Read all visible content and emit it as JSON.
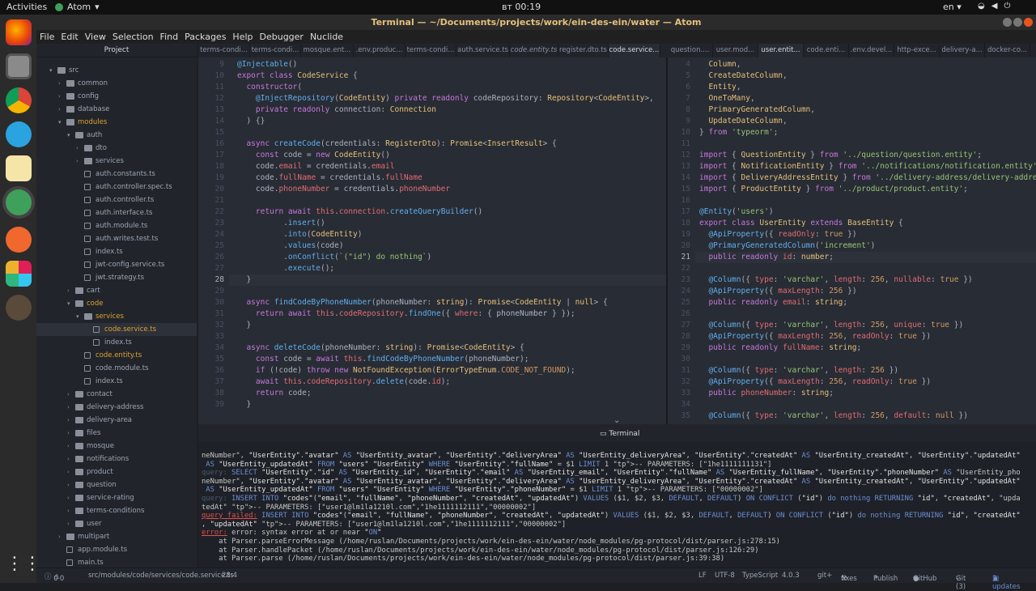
{
  "topbar": {
    "activities": "Activities",
    "app": "Atom",
    "clock": "вт 00:19",
    "lang": "en"
  },
  "window": {
    "title": "Terminal — ~/Documents/projects/work/ein-des-ein/water — Atom"
  },
  "menu": [
    "File",
    "Edit",
    "View",
    "Selection",
    "Find",
    "Packages",
    "Help",
    "Debugger",
    "Nuclide"
  ],
  "tree": {
    "header": "Project",
    "items": [
      {
        "label": "src",
        "depth": 0,
        "type": "folder",
        "open": true
      },
      {
        "label": "common",
        "depth": 1,
        "type": "folder"
      },
      {
        "label": "config",
        "depth": 1,
        "type": "folder"
      },
      {
        "label": "database",
        "depth": 1,
        "type": "folder"
      },
      {
        "label": "modules",
        "depth": 1,
        "type": "folder",
        "open": true,
        "hl": "orange"
      },
      {
        "label": "auth",
        "depth": 2,
        "type": "folder",
        "open": true
      },
      {
        "label": "dto",
        "depth": 3,
        "type": "folder"
      },
      {
        "label": "services",
        "depth": 3,
        "type": "folder"
      },
      {
        "label": "auth.constants.ts",
        "depth": 3,
        "type": "file"
      },
      {
        "label": "auth.controller.spec.ts",
        "depth": 3,
        "type": "file"
      },
      {
        "label": "auth.controller.ts",
        "depth": 3,
        "type": "file"
      },
      {
        "label": "auth.interface.ts",
        "depth": 3,
        "type": "file"
      },
      {
        "label": "auth.module.ts",
        "depth": 3,
        "type": "file"
      },
      {
        "label": "auth.writes.test.ts",
        "depth": 3,
        "type": "file"
      },
      {
        "label": "index.ts",
        "depth": 3,
        "type": "file"
      },
      {
        "label": "jwt-config.service.ts",
        "depth": 3,
        "type": "file"
      },
      {
        "label": "jwt.strategy.ts",
        "depth": 3,
        "type": "file"
      },
      {
        "label": "cart",
        "depth": 2,
        "type": "folder"
      },
      {
        "label": "code",
        "depth": 2,
        "type": "folder",
        "open": true,
        "hl": "orange"
      },
      {
        "label": "services",
        "depth": 3,
        "type": "folder",
        "open": true,
        "hl": "orange"
      },
      {
        "label": "code.service.ts",
        "depth": 4,
        "type": "file",
        "hl": "orange",
        "sel": true
      },
      {
        "label": "index.ts",
        "depth": 4,
        "type": "file"
      },
      {
        "label": "code.entity.ts",
        "depth": 3,
        "type": "file",
        "hl": "orange"
      },
      {
        "label": "code.module.ts",
        "depth": 3,
        "type": "file"
      },
      {
        "label": "index.ts",
        "depth": 3,
        "type": "file"
      },
      {
        "label": "contact",
        "depth": 2,
        "type": "folder"
      },
      {
        "label": "delivery-address",
        "depth": 2,
        "type": "folder"
      },
      {
        "label": "delivery-area",
        "depth": 2,
        "type": "folder"
      },
      {
        "label": "files",
        "depth": 2,
        "type": "folder"
      },
      {
        "label": "mosque",
        "depth": 2,
        "type": "folder"
      },
      {
        "label": "notifications",
        "depth": 2,
        "type": "folder"
      },
      {
        "label": "product",
        "depth": 2,
        "type": "folder"
      },
      {
        "label": "question",
        "depth": 2,
        "type": "folder"
      },
      {
        "label": "service-rating",
        "depth": 2,
        "type": "folder"
      },
      {
        "label": "terms-conditions",
        "depth": 2,
        "type": "folder"
      },
      {
        "label": "user",
        "depth": 2,
        "type": "folder"
      },
      {
        "label": "multipart",
        "depth": 1,
        "type": "folder"
      },
      {
        "label": "app.module.ts",
        "depth": 1,
        "type": "file"
      },
      {
        "label": "main.ts",
        "depth": 1,
        "type": "file"
      }
    ]
  },
  "tabs_left": [
    "terms-condi...",
    "terms-condi...",
    "mosque.ent...",
    ".env.produc...",
    "terms-condi...",
    "auth.service.ts",
    "code.entity.ts",
    "register.dto.ts",
    "code.service..."
  ],
  "tabs_right": [
    "question....",
    "user.mod...",
    "user.entit...",
    "code.enti...",
    ".env.devel...",
    "http-exce...",
    "delivery-a...",
    "docker-co..."
  ],
  "left_code": [
    {
      "n": "9",
      "html": "<span class='f'>@Injectable</span>()"
    },
    {
      "n": "10",
      "html": "<span class='k'>export class</span> <span class='t'>CodeService</span> {"
    },
    {
      "n": "11",
      "html": "  <span class='k'>constructor</span>("
    },
    {
      "n": "12",
      "html": "    <span class='f'>@InjectRepository</span>(<span class='t'>CodeEntity</span>) <span class='k'>private readonly</span> codeRepository: <span class='t'>Repository</span>&lt;<span class='t'>CodeEntity</span>&gt;,"
    },
    {
      "n": "13",
      "html": "    <span class='k'>private readonly</span> connection: <span class='t'>Connection</span>"
    },
    {
      "n": "14",
      "html": "  ) {}"
    },
    {
      "n": "15",
      "html": ""
    },
    {
      "n": "16",
      "html": "  <span class='k'>async</span> <span class='f'>createCode</span>(credentials: <span class='t'>RegisterDto</span>): <span class='t'>Promise</span>&lt;<span class='t'>InsertResult</span>&gt; {"
    },
    {
      "n": "17",
      "html": "    <span class='k'>const</span> code = <span class='k'>new</span> <span class='t'>CodeEntity</span>()"
    },
    {
      "n": "18",
      "html": "    code.<span class='p'>email</span> = credentials.<span class='p'>email</span>"
    },
    {
      "n": "19",
      "html": "    code.<span class='p'>fullName</span> = credentials.<span class='p'>fullName</span>"
    },
    {
      "n": "20",
      "html": "    code.<span class='p'>phoneNumber</span> = credentials.<span class='p'>phoneNumber</span>"
    },
    {
      "n": "21",
      "html": ""
    },
    {
      "n": "22",
      "html": "    <span class='k'>return await</span> <span class='p'>this</span>.<span class='p'>connection</span>.<span class='f'>createQueryBuilder</span>()"
    },
    {
      "n": "23",
      "html": "          .<span class='f'>insert</span>()"
    },
    {
      "n": "24",
      "html": "          .<span class='f'>into</span>(<span class='t'>CodeEntity</span>)"
    },
    {
      "n": "25",
      "html": "          .<span class='f'>values</span>(code)"
    },
    {
      "n": "26",
      "html": "          .<span class='f'>onConflict</span>(<span class='s'>`(\"id\") do nothing`</span>)"
    },
    {
      "n": "27",
      "html": "          .<span class='f'>execute</span>();"
    },
    {
      "n": "28",
      "html": "  }"
    },
    {
      "n": "29",
      "html": ""
    },
    {
      "n": "30",
      "html": "  <span class='k'>async</span> <span class='f'>findCodeByPhoneNumber</span>(phoneNumber: <span class='t'>string</span>): <span class='t'>Promise</span>&lt;<span class='t'>CodeEntity</span> | <span class='t'>null</span>&gt; {"
    },
    {
      "n": "31",
      "html": "    <span class='k'>return await</span> <span class='p'>this</span>.<span class='p'>codeRepository</span>.<span class='f'>findOne</span>({ <span class='p'>where</span>: { phoneNumber } });"
    },
    {
      "n": "32",
      "html": "  }"
    },
    {
      "n": "33",
      "html": ""
    },
    {
      "n": "34",
      "html": "  <span class='k'>async</span> <span class='f'>deleteCode</span>(phoneNumber: <span class='t'>string</span>): <span class='t'>Promise</span>&lt;<span class='t'>CodeEntity</span>&gt; {"
    },
    {
      "n": "35",
      "html": "    <span class='k'>const</span> code = <span class='k'>await</span> <span class='p'>this</span>.<span class='f'>findCodeByPhoneNumber</span>(phoneNumber);"
    },
    {
      "n": "36",
      "html": "    <span class='k'>if</span> (!code) <span class='k'>throw new</span> <span class='t'>NotFoundException</span>(<span class='t'>ErrorTypeEnum</span>.<span class='n'>CODE_NOT_FOUND</span>);"
    },
    {
      "n": "37",
      "html": "    <span class='k'>await</span> <span class='p'>this</span>.<span class='p'>codeRepository</span>.<span class='f'>delete</span>(code.<span class='p'>id</span>);"
    },
    {
      "n": "38",
      "html": "    <span class='k'>return</span> code;"
    },
    {
      "n": "39",
      "html": "  }"
    }
  ],
  "right_code": [
    {
      "n": "4",
      "html": "  <span class='t'>Column</span>,"
    },
    {
      "n": "5",
      "html": "  <span class='t'>CreateDateColumn</span>,"
    },
    {
      "n": "6",
      "html": "  <span class='t'>Entity</span>,"
    },
    {
      "n": "7",
      "html": "  <span class='t'>OneToMany</span>,"
    },
    {
      "n": "8",
      "html": "  <span class='t'>PrimaryGeneratedColumn</span>,"
    },
    {
      "n": "9",
      "html": "  <span class='t'>UpdateDateColumn</span>,"
    },
    {
      "n": "10",
      "html": "} <span class='k'>from</span> <span class='s'>'typeorm'</span>;"
    },
    {
      "n": "11",
      "html": ""
    },
    {
      "n": "12",
      "html": "<span class='k'>import</span> { <span class='t'>QuestionEntity</span> } <span class='k'>from</span> <span class='s'>'../question/question.entity'</span>;"
    },
    {
      "n": "13",
      "html": "<span class='k'>import</span> { <span class='t'>NotificationEntity</span> } <span class='k'>from</span> <span class='s'>'../notifications/notification.entity'</span>"
    },
    {
      "n": "14",
      "html": "<span class='k'>import</span> { <span class='t'>DeliveryAddressEntity</span> } <span class='k'>from</span> <span class='s'>'../delivery-address/delivery-addre</span>"
    },
    {
      "n": "15",
      "html": "<span class='k'>import</span> { <span class='t'>ProductEntity</span> } <span class='k'>from</span> <span class='s'>'../product/product.entity'</span>;"
    },
    {
      "n": "16",
      "html": ""
    },
    {
      "n": "17",
      "html": "<span class='f'>@Entity</span>(<span class='s'>'users'</span>)"
    },
    {
      "n": "18",
      "html": "<span class='k'>export class</span> <span class='t'>UserEntity</span> <span class='k'>extends</span> <span class='t'>BaseEntity</span> {"
    },
    {
      "n": "19",
      "html": "  <span class='f'>@ApiProperty</span>({ <span class='p'>readOnly</span>: <span class='n'>true</span> })"
    },
    {
      "n": "20",
      "html": "  <span class='f'>@PrimaryGeneratedColumn</span>(<span class='s'>'increment'</span>)"
    },
    {
      "n": "21",
      "html": "  <span class='k'>public readonly</span> <span class='p'>id</span>: <span class='t'>number</span>;"
    },
    {
      "n": "22",
      "html": ""
    },
    {
      "n": "23",
      "html": "  <span class='f'>@Column</span>({ <span class='p'>type</span>: <span class='s'>'varchar'</span>, <span class='p'>length</span>: <span class='n'>256</span>, <span class='p'>nullable</span>: <span class='n'>true</span> })"
    },
    {
      "n": "24",
      "html": "  <span class='f'>@ApiProperty</span>({ <span class='p'>maxLength</span>: <span class='n'>256</span> })"
    },
    {
      "n": "25",
      "html": "  <span class='k'>public readonly</span> <span class='p'>email</span>: <span class='t'>string</span>;"
    },
    {
      "n": "26",
      "html": ""
    },
    {
      "n": "27",
      "html": "  <span class='f'>@Column</span>({ <span class='p'>type</span>: <span class='s'>'varchar'</span>, <span class='p'>length</span>: <span class='n'>256</span>, <span class='p'>unique</span>: <span class='n'>true</span> })"
    },
    {
      "n": "28",
      "html": "  <span class='f'>@ApiProperty</span>({ <span class='p'>maxLength</span>: <span class='n'>256</span>, <span class='p'>readOnly</span>: <span class='n'>true</span> })"
    },
    {
      "n": "29",
      "html": "  <span class='k'>public readonly</span> <span class='p'>fullName</span>: <span class='t'>string</span>;"
    },
    {
      "n": "30",
      "html": ""
    },
    {
      "n": "31",
      "html": "  <span class='f'>@Column</span>({ <span class='p'>type</span>: <span class='s'>'varchar'</span>, <span class='p'>length</span>: <span class='n'>256</span> })"
    },
    {
      "n": "32",
      "html": "  <span class='f'>@ApiProperty</span>({ <span class='p'>maxLength</span>: <span class='n'>256</span>, <span class='p'>readOnly</span>: <span class='n'>true</span> })"
    },
    {
      "n": "33",
      "html": "  <span class='k'>public</span> <span class='p'>phoneNumber</span>: <span class='t'>string</span>;"
    },
    {
      "n": "34",
      "html": ""
    },
    {
      "n": "35",
      "html": "  <span class='f'>@Column</span>({ <span class='p'>type</span>: <span class='s'>'varchar'</span>, <span class='p'>length</span>: <span class='n'>256</span>, <span class='p'>default</span>: <span class='n'>null</span> })"
    }
  ],
  "terminal": {
    "title": "Terminal",
    "lines": [
      "neNumber\", \"UserEntity\".\"avatar\" AS \"UserEntity_avatar\", \"UserEntity\".\"deliveryArea\" AS \"UserEntity_deliveryArea\", \"UserEntity\".\"createdAt\" AS \"UserEntity_createdAt\", \"UserEntity\".\"updatedAt\"",
      " AS \"UserEntity_updatedAt\" FROM \"users\" \"UserEntity\" WHERE \"UserEntity\".\"fullName\" = $1 LIMIT 1 -- PARAMETERS: [\"1he1111111131\"]",
      "query: SELECT \"UserEntity\".\"id\" AS \"UserEntity_id\", \"UserEntity\".\"email\" AS \"UserEntity_email\", \"UserEntity\".\"fullName\" AS \"UserEntity_fullName\", \"UserEntity\".\"phoneNumber\" AS \"UserEntity_pho",
      "neNumber\", \"UserEntity\".\"avatar\" AS \"UserEntity_avatar\", \"UserEntity\".\"deliveryArea\" AS \"UserEntity_deliveryArea\", \"UserEntity\".\"createdAt\" AS \"UserEntity_createdAt\", \"UserEntity\".\"updatedAt\"",
      " AS \"UserEntity_updatedAt\" FROM \"users\" \"UserEntity\" WHERE \"UserEntity\".\"phoneNumber\" = $1 LIMIT 1 -- PARAMETERS: [\"00000002\"]",
      "query: INSERT INTO \"codes\"(\"email\", \"fullName\", \"phoneNumber\", \"createdAt\", \"updatedAt\") VALUES ($1, $2, $3, DEFAULT, DEFAULT) ON CONFLICT (\"id\") do nothing RETURNING \"id\", \"createdAt\", \"upda",
      "tedAt\" -- PARAMETERS: [\"user1@lm1la1210l.com\",\"1he1111112111\",\"00000002\"]",
      "query failed: INSERT INTO \"codes\"(\"email\", \"fullName\", \"phoneNumber\", \"createdAt\", \"updatedAt\") VALUES ($1, $2, $3, DEFAULT, DEFAULT) ON CONFLICT (\"id\") do nothing RETURNING \"id\", \"createdAt\"",
      ", \"updatedAt\" -- PARAMETERS: [\"user1@lm1la1210l.com\",\"1he1111112111\",\"00000002\"]",
      "error: error: syntax error at or near \"ON\"",
      "    at Parser.parseErrorMessage (/home/ruslan/Documents/projects/work/ein-des-ein/water/node_modules/pg-protocol/dist/parser.js:278:15)",
      "    at Parser.handlePacket (/home/ruslan/Documents/projects/work/ein-des-ein/water/node_modules/pg-protocol/dist/parser.js:126:29)",
      "    at Parser.parse (/home/ruslan/Documents/projects/work/ein-des-ein/water/node_modules/pg-protocol/dist/parser.js:39:38)"
    ]
  },
  "status": {
    "errors": "0",
    "warnings": "0",
    "path": "src/modules/code/services/code.service.ts",
    "cursor": "28:4",
    "eol": "LF",
    "encoding": "UTF-8",
    "grammar": "TypeScript",
    "version": "4.0.3",
    "git": "git+",
    "fixes": "fixes",
    "publish": "Publish",
    "github": "GitHub",
    "gitcount": "Git (3)",
    "updates": "3 updates"
  }
}
